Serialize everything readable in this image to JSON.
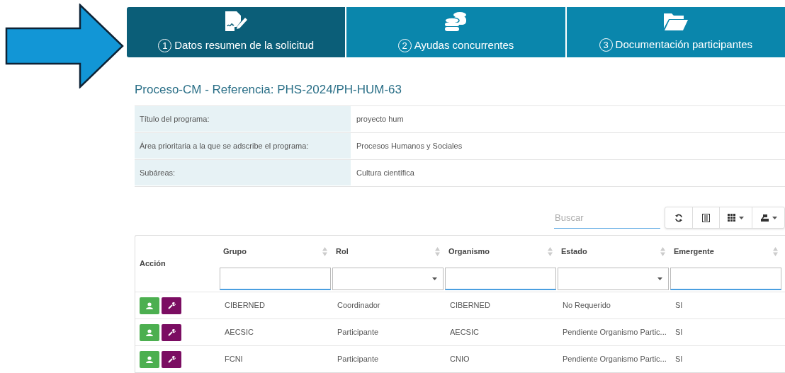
{
  "tabs": [
    {
      "number": "1",
      "label": "Datos resumen de la solicitud",
      "kind": "signature",
      "selected": true
    },
    {
      "number": "2",
      "label": "Ayudas concurrentes",
      "kind": "coins",
      "selected": false
    },
    {
      "number": "3",
      "label": "Documentación participantes",
      "kind": "folder",
      "selected": false
    }
  ],
  "heading": "Proceso-CM - Referencia: PHS-2024/PH-HUM-63",
  "details": [
    {
      "label": "Título del programa:",
      "value": "proyecto hum"
    },
    {
      "label": "Área prioritaria a la que se adscribe el programa:",
      "value": "Procesos Humanos y Sociales"
    },
    {
      "label": "Subáreas:",
      "value": "Cultura científica"
    }
  ],
  "search": {
    "placeholder": "Buscar"
  },
  "toolbar": [
    {
      "kind": "refresh",
      "menu": false
    },
    {
      "kind": "list",
      "menu": false
    },
    {
      "kind": "columns",
      "menu": true
    },
    {
      "kind": "export",
      "menu": true
    }
  ],
  "table": {
    "action_column": "Acción",
    "columns": [
      {
        "label": "Grupo",
        "kind": "text"
      },
      {
        "label": "Rol",
        "kind": "select"
      },
      {
        "label": "Organismo",
        "kind": "text"
      },
      {
        "label": "Estado",
        "kind": "select"
      },
      {
        "label": "Emergente",
        "kind": "text"
      }
    ],
    "rows": [
      [
        "CIBERNED",
        "Coordinador",
        "CIBERNED",
        "No Requerido",
        "SI"
      ],
      [
        "AECSIC",
        "Participante",
        "AECSIC",
        "Pendiente Organismo Partic...",
        "SI"
      ],
      [
        "FCNI",
        "Participante",
        "CNIO",
        "Pendiente Organismo Partic...",
        "SI"
      ]
    ]
  }
}
